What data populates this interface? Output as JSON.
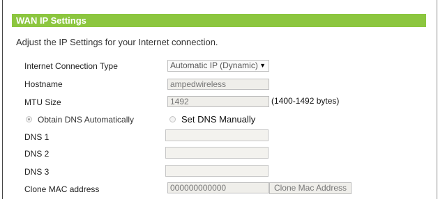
{
  "section": {
    "title": "WAN IP Settings"
  },
  "description": "Adjust the IP Settings for your Internet connection.",
  "connection_type": {
    "label": "Internet Connection Type",
    "selected": "Automatic IP (Dynamic)"
  },
  "hostname": {
    "label": "Hostname",
    "value": "ampedwireless"
  },
  "mtu": {
    "label": "MTU Size",
    "value": "1492",
    "unit": "(1400-1492 bytes)"
  },
  "dns_mode": {
    "auto_label": "Obtain DNS Automatically",
    "manual_label": "Set DNS Manually",
    "selected": "auto"
  },
  "dns": [
    {
      "label": "DNS 1",
      "value": ""
    },
    {
      "label": "DNS 2",
      "value": ""
    },
    {
      "label": "DNS 3",
      "value": ""
    }
  ],
  "clone_mac": {
    "label": "Clone MAC address",
    "value": "000000000000",
    "button_label": "Clone Mac Address"
  },
  "colors": {
    "header_bg": "#8cc63f",
    "field_bg": "#efeeea",
    "field_border": "#bdbdbd"
  }
}
